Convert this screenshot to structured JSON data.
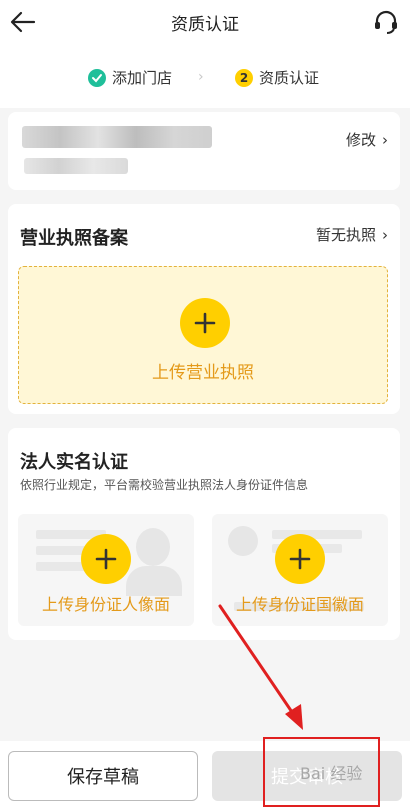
{
  "header": {
    "title": "资质认证",
    "back_icon": "back-arrow-icon",
    "service_icon": "headset-icon"
  },
  "steps": [
    {
      "label": "添加门店",
      "state": "done"
    },
    {
      "label": "资质认证",
      "number": "2",
      "state": "current"
    }
  ],
  "store_card": {
    "edit_label": "修改"
  },
  "license": {
    "title": "营业执照备案",
    "no_license_label": "暂无执照",
    "upload_label": "上传营业执照"
  },
  "legal": {
    "title": "法人实名认证",
    "description": "依照行业规定，平台需校验营业执照法人身份证件信息",
    "front_label": "上传身份证人像面",
    "back_label": "上传身份证国徽面"
  },
  "footer": {
    "save_label": "保存草稿",
    "submit_label": "提交审核"
  },
  "watermark": "Bai 经验",
  "colors": {
    "accent": "#ffcf00",
    "upload_text": "#e49a1a",
    "success": "#1fbf9a",
    "annotation": "#e02020"
  }
}
